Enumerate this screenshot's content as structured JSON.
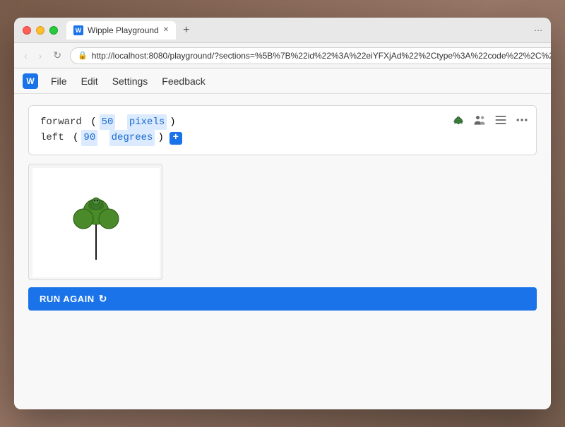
{
  "window": {
    "title": "Wipple Playground",
    "tab_label": "Wipple Playground",
    "url": "http://localhost:8080/playground/?sections=%5B%7B%22id%22%3A%22eiYFXjAd%22%2Ctype%3A%22code%22%2C%22v...",
    "favicon_letter": "W"
  },
  "menu": {
    "logo_letter": "W",
    "items": [
      "File",
      "Edit",
      "Settings",
      "Feedback"
    ]
  },
  "toolbar": {
    "turtle_label": "turtle-icon",
    "people_label": "people-icon",
    "list_label": "list-icon",
    "more_label": "more-icon"
  },
  "code": {
    "line1_keyword": "forward",
    "line1_number": "50",
    "line1_unit": "pixels",
    "line2_keyword": "left",
    "line2_number": "90",
    "line2_unit": "degrees"
  },
  "run_again": {
    "label": "RUN AGAIN"
  },
  "nav": {
    "back": "‹",
    "forward": "›",
    "refresh": "↻"
  }
}
